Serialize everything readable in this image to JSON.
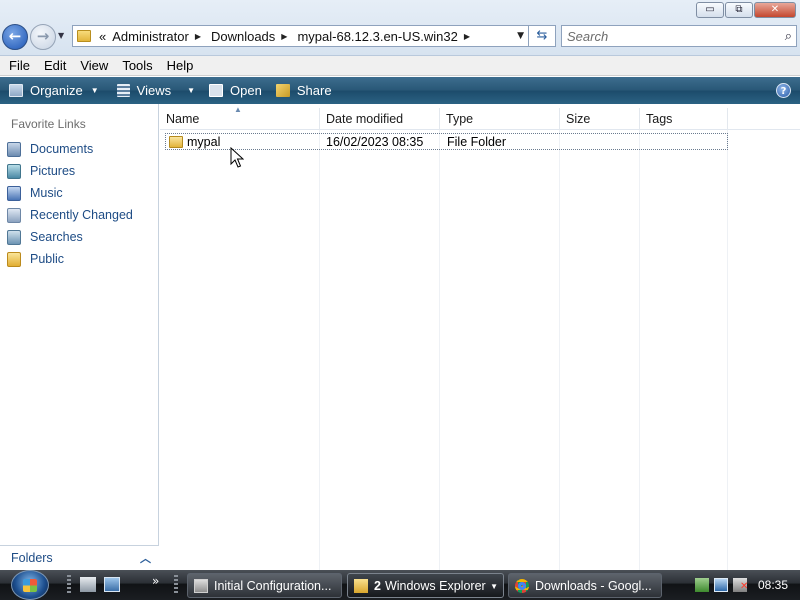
{
  "window": {
    "minimize": "▭",
    "maximize": "⧉",
    "close": "✕"
  },
  "address": {
    "overflow": "«",
    "breadcrumbs": [
      "Administrator",
      "Downloads",
      "mypal-68.12.3.en-US.win32"
    ]
  },
  "search": {
    "placeholder": "Search"
  },
  "menu": [
    "File",
    "Edit",
    "View",
    "Tools",
    "Help"
  ],
  "toolbar": {
    "organize": "Organize",
    "views": "Views",
    "open": "Open",
    "share": "Share"
  },
  "navpane": {
    "title": "Favorite Links",
    "links": [
      {
        "label": "Documents",
        "icon": "documents-icon"
      },
      {
        "label": "Pictures",
        "icon": "pictures-icon"
      },
      {
        "label": "Music",
        "icon": "music-icon"
      },
      {
        "label": "Recently Changed",
        "icon": "recently-changed-icon"
      },
      {
        "label": "Searches",
        "icon": "searches-icon"
      },
      {
        "label": "Public",
        "icon": "public-folder-icon"
      }
    ],
    "folders": "Folders"
  },
  "filelist": {
    "columns": [
      "Name",
      "Date modified",
      "Type",
      "Size",
      "Tags"
    ],
    "sorted_column": "Name",
    "rows": [
      {
        "name": "mypal",
        "date_modified": "16/02/2023 08:35",
        "type": "File Folder",
        "size": "",
        "tags": ""
      }
    ]
  },
  "taskbar": {
    "quicklaunch_more": "»",
    "buttons": [
      {
        "label": "Initial Configuration...",
        "active": false
      },
      {
        "count": "2",
        "label": "Windows Explorer",
        "active": true
      },
      {
        "label": "Downloads - Googl...",
        "active": false
      }
    ],
    "clock": "08:35"
  },
  "colors": {
    "link": "#1e4c85",
    "toolbar": "#285776",
    "taskbar": "#1b1e22"
  }
}
